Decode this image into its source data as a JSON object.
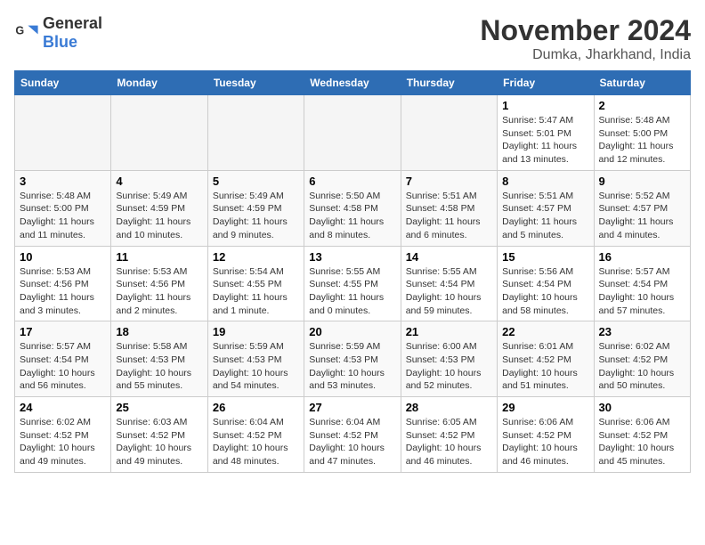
{
  "logo": {
    "general": "General",
    "blue": "Blue"
  },
  "title": "November 2024",
  "location": "Dumka, Jharkhand, India",
  "weekdays": [
    "Sunday",
    "Monday",
    "Tuesday",
    "Wednesday",
    "Thursday",
    "Friday",
    "Saturday"
  ],
  "weeks": [
    [
      {
        "day": "",
        "info": ""
      },
      {
        "day": "",
        "info": ""
      },
      {
        "day": "",
        "info": ""
      },
      {
        "day": "",
        "info": ""
      },
      {
        "day": "",
        "info": ""
      },
      {
        "day": "1",
        "info": "Sunrise: 5:47 AM\nSunset: 5:01 PM\nDaylight: 11 hours and 13 minutes."
      },
      {
        "day": "2",
        "info": "Sunrise: 5:48 AM\nSunset: 5:00 PM\nDaylight: 11 hours and 12 minutes."
      }
    ],
    [
      {
        "day": "3",
        "info": "Sunrise: 5:48 AM\nSunset: 5:00 PM\nDaylight: 11 hours and 11 minutes."
      },
      {
        "day": "4",
        "info": "Sunrise: 5:49 AM\nSunset: 4:59 PM\nDaylight: 11 hours and 10 minutes."
      },
      {
        "day": "5",
        "info": "Sunrise: 5:49 AM\nSunset: 4:59 PM\nDaylight: 11 hours and 9 minutes."
      },
      {
        "day": "6",
        "info": "Sunrise: 5:50 AM\nSunset: 4:58 PM\nDaylight: 11 hours and 8 minutes."
      },
      {
        "day": "7",
        "info": "Sunrise: 5:51 AM\nSunset: 4:58 PM\nDaylight: 11 hours and 6 minutes."
      },
      {
        "day": "8",
        "info": "Sunrise: 5:51 AM\nSunset: 4:57 PM\nDaylight: 11 hours and 5 minutes."
      },
      {
        "day": "9",
        "info": "Sunrise: 5:52 AM\nSunset: 4:57 PM\nDaylight: 11 hours and 4 minutes."
      }
    ],
    [
      {
        "day": "10",
        "info": "Sunrise: 5:53 AM\nSunset: 4:56 PM\nDaylight: 11 hours and 3 minutes."
      },
      {
        "day": "11",
        "info": "Sunrise: 5:53 AM\nSunset: 4:56 PM\nDaylight: 11 hours and 2 minutes."
      },
      {
        "day": "12",
        "info": "Sunrise: 5:54 AM\nSunset: 4:55 PM\nDaylight: 11 hours and 1 minute."
      },
      {
        "day": "13",
        "info": "Sunrise: 5:55 AM\nSunset: 4:55 PM\nDaylight: 11 hours and 0 minutes."
      },
      {
        "day": "14",
        "info": "Sunrise: 5:55 AM\nSunset: 4:54 PM\nDaylight: 10 hours and 59 minutes."
      },
      {
        "day": "15",
        "info": "Sunrise: 5:56 AM\nSunset: 4:54 PM\nDaylight: 10 hours and 58 minutes."
      },
      {
        "day": "16",
        "info": "Sunrise: 5:57 AM\nSunset: 4:54 PM\nDaylight: 10 hours and 57 minutes."
      }
    ],
    [
      {
        "day": "17",
        "info": "Sunrise: 5:57 AM\nSunset: 4:54 PM\nDaylight: 10 hours and 56 minutes."
      },
      {
        "day": "18",
        "info": "Sunrise: 5:58 AM\nSunset: 4:53 PM\nDaylight: 10 hours and 55 minutes."
      },
      {
        "day": "19",
        "info": "Sunrise: 5:59 AM\nSunset: 4:53 PM\nDaylight: 10 hours and 54 minutes."
      },
      {
        "day": "20",
        "info": "Sunrise: 5:59 AM\nSunset: 4:53 PM\nDaylight: 10 hours and 53 minutes."
      },
      {
        "day": "21",
        "info": "Sunrise: 6:00 AM\nSunset: 4:53 PM\nDaylight: 10 hours and 52 minutes."
      },
      {
        "day": "22",
        "info": "Sunrise: 6:01 AM\nSunset: 4:52 PM\nDaylight: 10 hours and 51 minutes."
      },
      {
        "day": "23",
        "info": "Sunrise: 6:02 AM\nSunset: 4:52 PM\nDaylight: 10 hours and 50 minutes."
      }
    ],
    [
      {
        "day": "24",
        "info": "Sunrise: 6:02 AM\nSunset: 4:52 PM\nDaylight: 10 hours and 49 minutes."
      },
      {
        "day": "25",
        "info": "Sunrise: 6:03 AM\nSunset: 4:52 PM\nDaylight: 10 hours and 49 minutes."
      },
      {
        "day": "26",
        "info": "Sunrise: 6:04 AM\nSunset: 4:52 PM\nDaylight: 10 hours and 48 minutes."
      },
      {
        "day": "27",
        "info": "Sunrise: 6:04 AM\nSunset: 4:52 PM\nDaylight: 10 hours and 47 minutes."
      },
      {
        "day": "28",
        "info": "Sunrise: 6:05 AM\nSunset: 4:52 PM\nDaylight: 10 hours and 46 minutes."
      },
      {
        "day": "29",
        "info": "Sunrise: 6:06 AM\nSunset: 4:52 PM\nDaylight: 10 hours and 46 minutes."
      },
      {
        "day": "30",
        "info": "Sunrise: 6:06 AM\nSunset: 4:52 PM\nDaylight: 10 hours and 45 minutes."
      }
    ]
  ]
}
